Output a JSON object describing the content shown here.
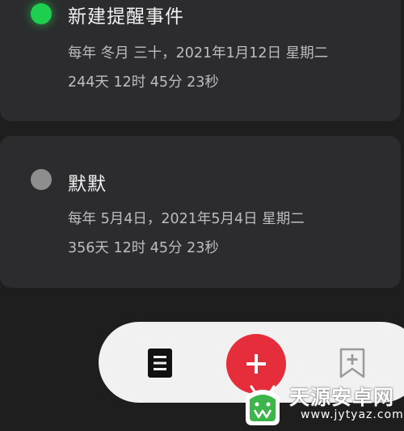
{
  "events": [
    {
      "title": "新建提醒事件",
      "date_line": "每年 冬月 三十，2021年1月12日 星期二",
      "countdown": "244天 12时 45分 23秒",
      "dot_color": "#1ecf4f"
    },
    {
      "title": "默默",
      "date_line": "每年 5月4日，2021年5月4日 星期二",
      "countdown": "356天 12时 45分 23秒",
      "dot_color": "#8e8e8e"
    }
  ],
  "bottom_bar": {
    "items": [
      {
        "icon": "list-document-icon"
      },
      {
        "icon": "plus-icon"
      },
      {
        "icon": "bookmark-add-icon"
      }
    ],
    "accent_color": "#e52d3c"
  },
  "watermark": {
    "name": "天源安卓网",
    "url": "www.jytyaz.com"
  }
}
